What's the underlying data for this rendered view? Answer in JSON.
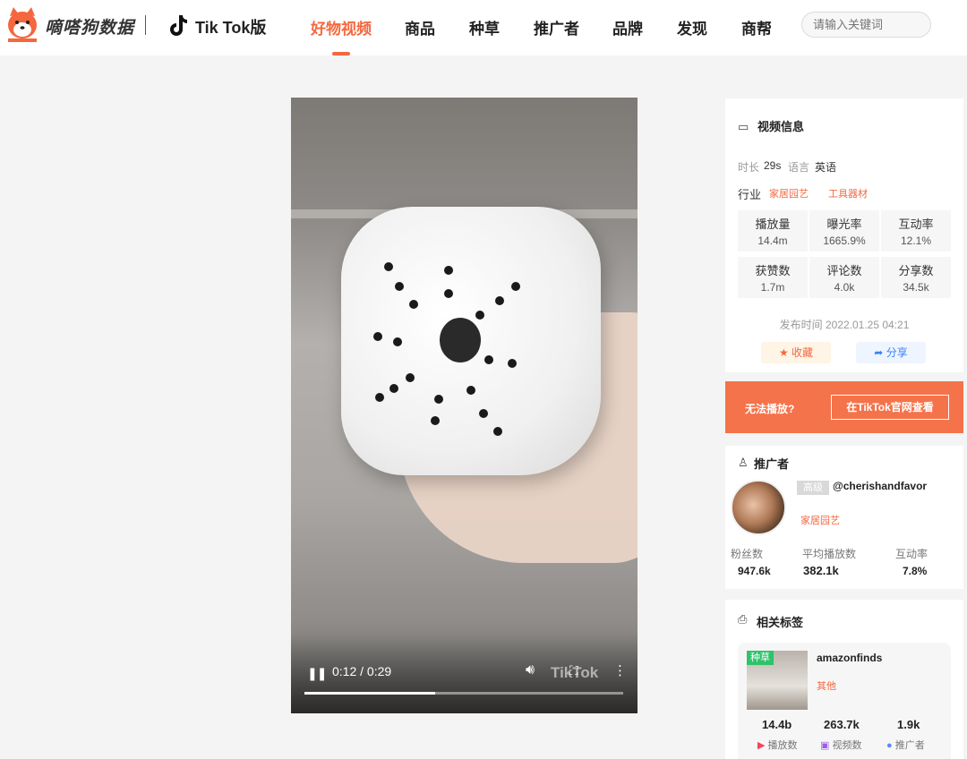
{
  "header": {
    "brand": "嘀嗒狗数据",
    "tiktok_label": "Tik Tok版",
    "nav": [
      "好物视频",
      "商品",
      "种草",
      "推广者",
      "品牌",
      "发现",
      "商帮"
    ],
    "active_nav": "好物视频",
    "search_placeholder": "请输入关键词"
  },
  "video": {
    "time": "0:12 / 0:29",
    "progress": 0.41,
    "watermark": "TikTok"
  },
  "video_info": {
    "title": "视频信息",
    "duration_label": "时长",
    "duration": "29s",
    "language_label": "语言",
    "language": "英语",
    "industry_label": "行业",
    "industry_tags": [
      "家居园艺",
      "工具器材"
    ],
    "metrics": [
      {
        "label": "播放量",
        "value": "14.4m"
      },
      {
        "label": "曝光率",
        "value": "1665.9%"
      },
      {
        "label": "互动率",
        "value": "12.1%"
      },
      {
        "label": "获赞数",
        "value": "1.7m"
      },
      {
        "label": "评论数",
        "value": "4.0k"
      },
      {
        "label": "分享数",
        "value": "34.5k"
      }
    ],
    "publish_time": "发布时间 2022.01.25 04:21",
    "favorite_label": "收藏",
    "share_label": "分享"
  },
  "banner": {
    "text": "无法播放?",
    "button": "在TikTok官网查看"
  },
  "promoter": {
    "title": "推广者",
    "label": "高级",
    "handle": "@cherishandfavor",
    "category": "家居园艺",
    "stats": [
      {
        "label": "粉丝数",
        "value": "947.6k"
      },
      {
        "label": "平均播放数",
        "value": "382.1k"
      },
      {
        "label": "互动率",
        "value": "7.8%"
      }
    ]
  },
  "related_tags": {
    "title": "相关标签",
    "card": {
      "badge": "种草",
      "name": "amazonfinds",
      "category": "其他",
      "stats": [
        {
          "value": "14.4b",
          "label": "播放数"
        },
        {
          "value": "263.7k",
          "label": "视频数"
        },
        {
          "value": "1.9k",
          "label": "推广者"
        }
      ]
    }
  },
  "colors": {
    "accent": "#f5673e",
    "banner": "#f5734a",
    "badge_green": "#2ec36a"
  }
}
